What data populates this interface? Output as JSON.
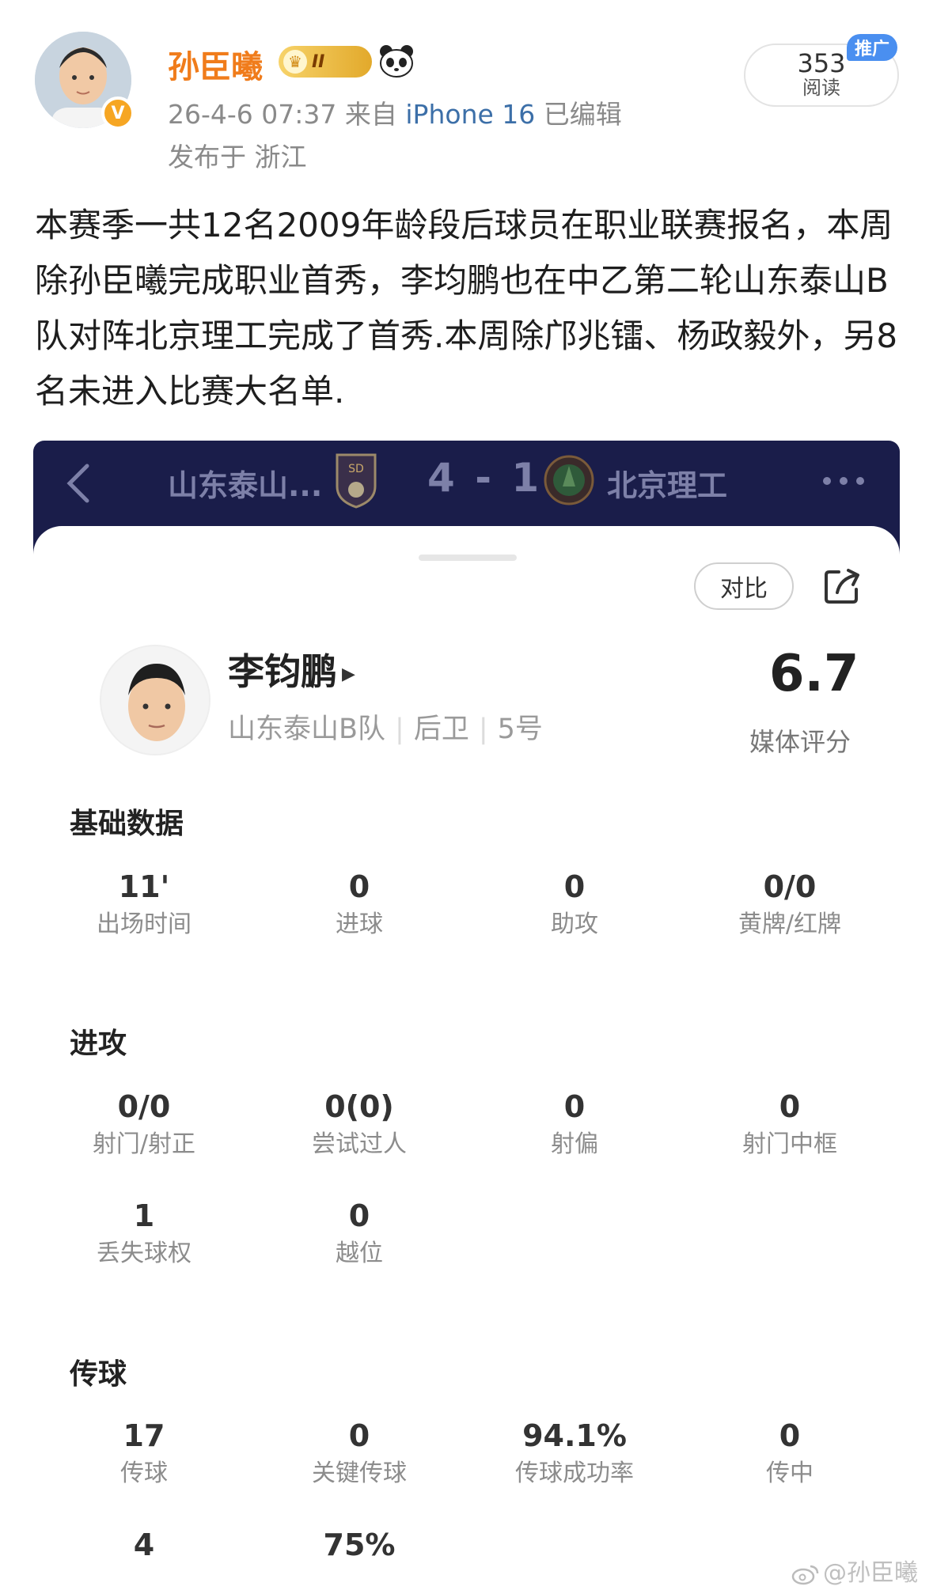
{
  "post": {
    "author": "孙臣曦",
    "badge_level": "II",
    "verified_mark": "V",
    "timestamp": "26-4-6 07:37",
    "source_prefix": "来自",
    "device": "iPhone 16",
    "edited": "已编辑",
    "location": "发布于 浙江",
    "read_count": "353",
    "read_label": "阅读",
    "promo_tag": "推广",
    "text": "本赛季一共12名2009年龄段后球员在职业联赛报名，本周除孙臣曦完成职业首秀，李均鹏也在中乙第二轮山东泰山B队对阵北京理工完成了首秀.本周除邝兆镭、杨政毅外，另8名未进入比赛大名单."
  },
  "match": {
    "home_team": "山东泰山...",
    "score": "4 - 1",
    "away_team": "北京理工"
  },
  "player": {
    "compare_label": "对比",
    "name": "李钧鹏",
    "team": "山东泰山B队",
    "position": "后卫",
    "number": "5号",
    "rating": "6.7",
    "rating_label": "媒体评分"
  },
  "sections": {
    "basic": {
      "title": "基础数据",
      "stats": [
        {
          "value": "11'",
          "label": "出场时间"
        },
        {
          "value": "0",
          "label": "进球"
        },
        {
          "value": "0",
          "label": "助攻"
        },
        {
          "value": "0/0",
          "label": "黄牌/红牌"
        }
      ]
    },
    "attack": {
      "title": "进攻",
      "stats": [
        {
          "value": "0/0",
          "label": "射门/射正"
        },
        {
          "value": "0(0)",
          "label": "尝试过人"
        },
        {
          "value": "0",
          "label": "射偏"
        },
        {
          "value": "0",
          "label": "射门中框"
        },
        {
          "value": "1",
          "label": "丢失球权"
        },
        {
          "value": "0",
          "label": "越位"
        }
      ]
    },
    "passing": {
      "title": "传球",
      "stats": [
        {
          "value": "17",
          "label": "传球"
        },
        {
          "value": "0",
          "label": "关键传球"
        },
        {
          "value": "94.1%",
          "label": "传球成功率"
        },
        {
          "value": "0",
          "label": "传中"
        },
        {
          "value": "4",
          "label": ""
        },
        {
          "value": "75%",
          "label": ""
        }
      ]
    }
  },
  "watermark": "@孙臣曦",
  "icons": {
    "back": "chevron-left-icon",
    "more": "more-dots-icon",
    "share": "share-icon",
    "panda": "panda-icon",
    "crown": "crown-icon",
    "weibo": "weibo-logo-icon"
  },
  "colors": {
    "author_name": "#f07c1b",
    "device_link": "#3c6fa8",
    "match_bar_bg": "#1a1d4a",
    "promo_tag": "#4a8ff0"
  }
}
